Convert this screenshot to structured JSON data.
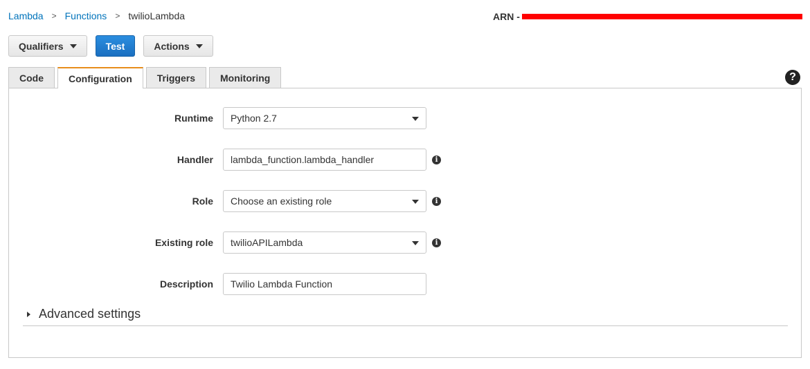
{
  "breadcrumb": {
    "items": [
      "Lambda",
      "Functions"
    ],
    "current": "twilioLambda",
    "separator": ">"
  },
  "arn": {
    "label": "ARN -"
  },
  "toolbar": {
    "qualifiers_label": "Qualifiers",
    "test_label": "Test",
    "actions_label": "Actions"
  },
  "tabs": [
    {
      "label": "Code"
    },
    {
      "label": "Configuration",
      "active": true
    },
    {
      "label": "Triggers"
    },
    {
      "label": "Monitoring"
    }
  ],
  "help_icon": {
    "glyph": "?",
    "icon": "help-icon"
  },
  "config": {
    "runtime": {
      "label": "Runtime",
      "value": "Python 2.7"
    },
    "handler": {
      "label": "Handler",
      "value": "lambda_function.lambda_handler"
    },
    "role": {
      "label": "Role",
      "value": "Choose an existing role"
    },
    "existing_role": {
      "label": "Existing role",
      "value": "twilioAPILambda"
    },
    "description": {
      "label": "Description",
      "value": "Twilio Lambda Function"
    }
  },
  "advanced_settings": {
    "label": "Advanced settings"
  },
  "colors": {
    "link": "#0073bb",
    "primary_button": "#1a6fc0",
    "active_tab_accent": "#e88d1b",
    "redaction": "#ff0000"
  }
}
